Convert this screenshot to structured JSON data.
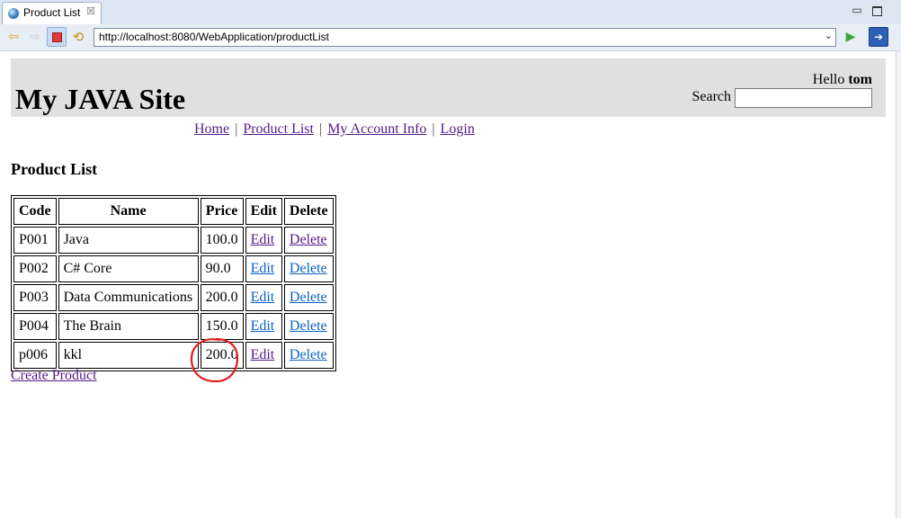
{
  "tab": {
    "title": "Product List",
    "close_glyph": "☒",
    "icon": "globe-icon"
  },
  "window": {
    "minimize_glyph": "▭",
    "maximize_icon": "maximize-icon"
  },
  "toolbar": {
    "back_icon": "back-arrow-icon",
    "forward_icon": "forward-arrow-icon",
    "stop_icon": "stop-icon",
    "refresh_icon": "refresh-icon",
    "go_icon": "go-icon",
    "external_icon": "open-external-icon",
    "url": "http://localhost:8080/WebApplication/productList"
  },
  "site": {
    "title": "My JAVA Site",
    "greeting_prefix": "Hello",
    "username": "tom",
    "search_label": "Search",
    "search_value": ""
  },
  "nav": {
    "home": "Home",
    "product_list": "Product List",
    "account": "My Account Info",
    "login": "Login",
    "separator": "|"
  },
  "page": {
    "heading": "Product List",
    "create_link": "Create Product"
  },
  "table": {
    "headers": [
      "Code",
      "Name",
      "Price",
      "Edit",
      "Delete"
    ],
    "rows": [
      {
        "code": "P001",
        "name": "Java",
        "price": "100.0",
        "edit": "Edit",
        "delete": "Delete"
      },
      {
        "code": "P002",
        "name": "C# Core",
        "price": "90.0",
        "edit": "Edit",
        "delete": "Delete"
      },
      {
        "code": "P003",
        "name": "Data Communications",
        "price": "200.0",
        "edit": "Edit",
        "delete": "Delete"
      },
      {
        "code": "P004",
        "name": "The Brain",
        "price": "150.0",
        "edit": "Edit",
        "delete": "Delete"
      },
      {
        "code": "p006",
        "name": "kkl",
        "price": "200.0",
        "edit": "Edit",
        "delete": "Delete"
      }
    ]
  },
  "colors": {
    "visited_link": "#551a8b",
    "unvisited_link": "#0b62c4",
    "annotation": "#e02020",
    "header_bg": "#e0e0e0"
  }
}
